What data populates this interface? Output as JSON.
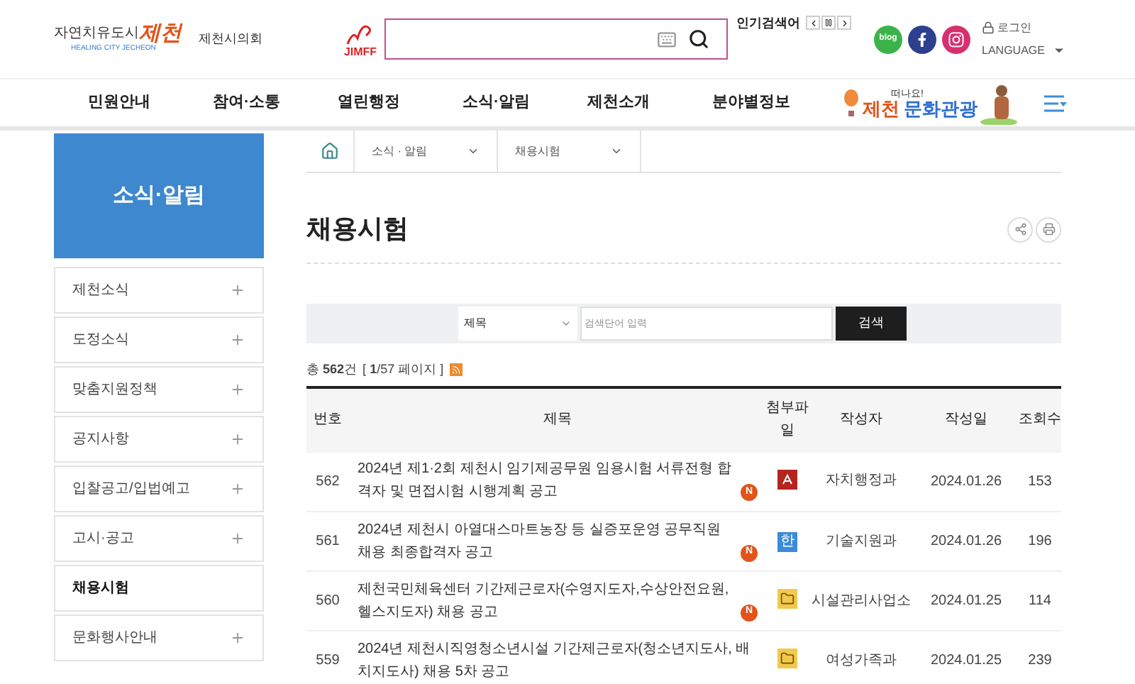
{
  "header": {
    "logo_title": "자연치유도시",
    "logo_city": "제천",
    "logo_subtitle": "HEALING CITY JECHEON",
    "council_link": "제천시의회",
    "festival_logo": "JIMFF",
    "popular_label": "인기검색어",
    "blog": "blog",
    "login": "로그인",
    "language": "LANGUAGE"
  },
  "nav": {
    "items": [
      "민원안내",
      "참여·소통",
      "열린행정",
      "소식·알림",
      "제천소개",
      "분야별정보"
    ],
    "banner_small": "떠나요!",
    "banner_city": "제천",
    "banner_main": "문화관광"
  },
  "breadcrumb": [
    "소식 · 알림",
    "채용시험"
  ],
  "sidebar": {
    "title": "소식·알림",
    "items": [
      {
        "label": "제천소식",
        "selected": false
      },
      {
        "label": "도정소식",
        "selected": false
      },
      {
        "label": "맞춤지원정책",
        "selected": false
      },
      {
        "label": "공지사항",
        "selected": false
      },
      {
        "label": "입찰공고/입법예고",
        "selected": false
      },
      {
        "label": "고시·공고",
        "selected": false
      },
      {
        "label": "채용시험",
        "selected": true
      },
      {
        "label": "문화행사안내",
        "selected": false
      }
    ]
  },
  "page_title": "채용시험",
  "search": {
    "field": "제목",
    "placeholder": "검색단어 입력",
    "button": "검색"
  },
  "summary": {
    "total": "총 **562**건",
    "pages": "[ **1**/57 페이지 ]"
  },
  "table": {
    "columns": [
      "번호",
      "제목",
      "첨부파일",
      "작성자",
      "작성일",
      "조회수"
    ],
    "rows": [
      {
        "no": "562",
        "title": "2024년 제1·2회 제천시 임기제공무원 임용시험 서류전형 합격자 및 면접시험 시행계획 공고",
        "badge": "N",
        "attachment": {
          "kind": "pdf"
        },
        "author": "자치행정과",
        "date": "2024.01.26",
        "views": "153"
      },
      {
        "no": "561",
        "title": "2024년 제천시 아열대스마트농장 등 실증포운영 공무직원 채용 최종합격자 공고",
        "badge": "N",
        "attachment": {
          "kind": "hwp",
          "label": "한"
        },
        "author": "기술지원과",
        "date": "2024.01.26",
        "views": "196"
      },
      {
        "no": "560",
        "title": "제천국민체육센터 기간제근로자(수영지도자,수상안전요원,헬스지도자) 채용 공고",
        "badge": "N",
        "attachment": {
          "kind": "folder"
        },
        "author": "시설관리사업소",
        "date": "2024.01.25",
        "views": "114"
      },
      {
        "no": "559",
        "title": "2024년 제천시직영청소년시설 기간제근로자(청소년지도사, 배치지도사) 채용 5차 공고",
        "attachment": {
          "kind": "folder"
        },
        "author": "여성가족과",
        "date": "2024.01.25",
        "views": "239"
      }
    ]
  }
}
